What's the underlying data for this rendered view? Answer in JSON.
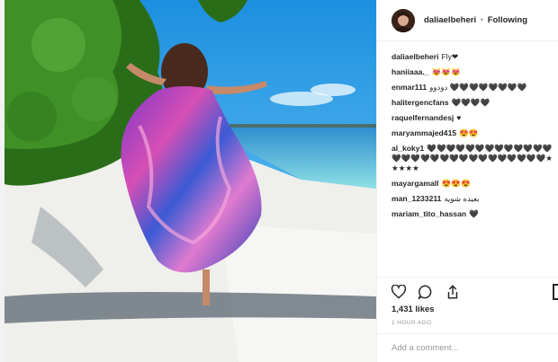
{
  "post": {
    "username": "daliaelbeheri",
    "separator": "•",
    "follow_status": "Following",
    "photo_alt": "Woman in colorful flowing dress walking on a beach"
  },
  "comments": [
    {
      "user": "daliaelbeheri",
      "text": "Fly❤"
    },
    {
      "user": "haniiaaa._",
      "text": "😻😻😻"
    },
    {
      "user": "enmar111",
      "text": "دودوو 🖤🖤🖤🖤🖤🖤🖤🖤"
    },
    {
      "user": "halitergencfans",
      "text": "🖤🖤🖤🖤"
    },
    {
      "user": "raquelfernandesj",
      "text": "♥"
    },
    {
      "user": "maryammajed415",
      "text": "😍😍"
    },
    {
      "user": "al_koky1",
      "text": "🖤🖤🖤🖤🖤🖤🖤🖤🖤🖤🖤🖤🖤🖤🖤🖤🖤🖤🖤🖤🖤🖤🖤🖤🖤🖤🖤🖤🖤★★★★★"
    },
    {
      "user": "mayargamall",
      "text": "😍😍😍"
    },
    {
      "user": "man_1233211",
      "text": "بعيده شويه"
    },
    {
      "user": "mariam_tito_hassan",
      "text": "🖤"
    }
  ],
  "actions": {
    "like_icon": "heart-outline-icon",
    "comment_icon": "comment-bubble-icon",
    "share_icon": "share-arrow-icon",
    "save_icon": "bookmark-icon"
  },
  "likes_text": "1,431 likes",
  "time_text": "1 HOUR AGO",
  "add_comment_placeholder": "Add a comment...",
  "colors": {
    "sky": "#39a6ea",
    "sea": "#5fc9de",
    "sand": "#f2f2f0",
    "foliage": "#2f7d1c",
    "dress_magenta": "#c44fb8",
    "dress_blue": "#3c5bd1"
  }
}
